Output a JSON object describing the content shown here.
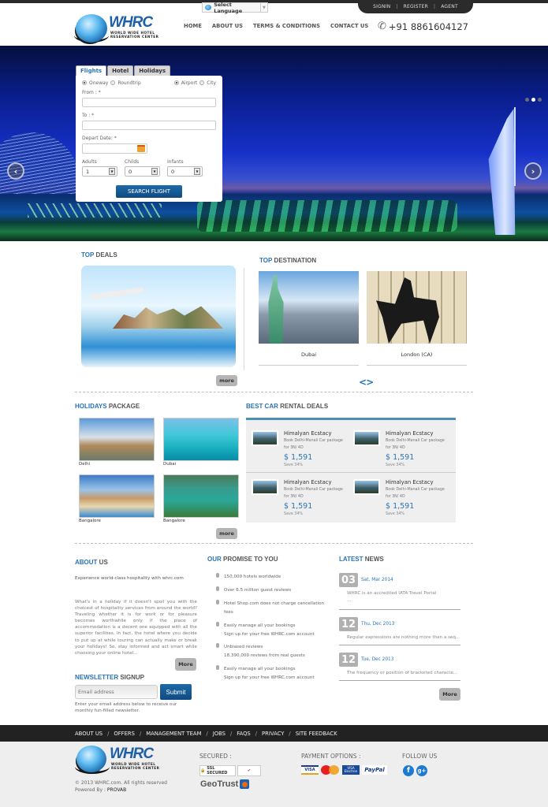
{
  "header": {
    "language_selector": "Select Language",
    "account_links": [
      "SIGNIN",
      "REGISTER",
      "AGENT"
    ],
    "logo": {
      "title": "WHRC",
      "subtitle_line1": "WORLD WIDE HOTEL",
      "subtitle_line2": "RESERVATION CENTER"
    },
    "nav": [
      "HOME",
      "ABOUT US",
      "TERMS & CONDITIONS",
      "CONTACT US"
    ],
    "phone": "+91 8861604127"
  },
  "hero": {
    "slides_total": 3,
    "active_slide": 2,
    "prev_icon": "chevron-left-icon",
    "next_icon": "chevron-right-icon"
  },
  "search": {
    "tabs": [
      "Flights",
      "Hotel",
      "Holidays"
    ],
    "active_tab": "Flights",
    "trip_type": {
      "options": [
        "Oneway",
        "Roundtrip"
      ],
      "selected": "Oneway"
    },
    "location_type": {
      "options": [
        "Airport",
        "City"
      ],
      "selected": "Airport"
    },
    "from_label": "From : *",
    "from_value": "",
    "to_label": "To : *",
    "to_value": "",
    "depart_label": "Depart Date: *",
    "depart_value": "",
    "adults_label": "Adults",
    "adults_value": "1",
    "childs_label": "Childs",
    "childs_value": "0",
    "infants_label": "Infants",
    "infants_value": "0",
    "submit_label": "SEARCH FLIGHT"
  },
  "top_deals": {
    "title_accent": "TOP",
    "title_rest": " DEALS",
    "more_label": "more"
  },
  "top_destination": {
    "title_accent": "TOP",
    "title_rest": " DESTINATION",
    "items": [
      {
        "name": "Dubai"
      },
      {
        "name": "London (CA)"
      }
    ],
    "prev_label": "<",
    "next_label": ">"
  },
  "holidays": {
    "title_accent": "HOLIDAYS",
    "title_rest": " PACKAGE",
    "items": [
      {
        "name": "Delhi"
      },
      {
        "name": "Dubai"
      },
      {
        "name": "Bangalore"
      },
      {
        "name": "Bangalore"
      }
    ],
    "more_label": "more"
  },
  "car_rentals": {
    "title_accent": "BEST CAR",
    "title_rest": " RENTAL DEALS",
    "items": [
      {
        "title": "Himalyan Ecstacy",
        "desc1": "Book Delhi-Manali Car package",
        "desc2": "for 3N/ 4D",
        "price": "$ 1,591",
        "save": "Save 34%"
      },
      {
        "title": "Himalyan Ecstacy",
        "desc1": "Book Delhi-Manali Car package",
        "desc2": "for 3N/ 4D",
        "price": "$ 1,591",
        "save": "Save 34%"
      },
      {
        "title": "Himalyan Ecstacy",
        "desc1": "Book Delhi-Manali Car package",
        "desc2": "for 3N/ 4D",
        "price": "$ 1,591",
        "save": "Save 34%"
      },
      {
        "title": "Himalyan Ecstacy",
        "desc1": "Book Delhi-Manali Car package",
        "desc2": "for 3N/ 4D",
        "price": "$ 1,591",
        "save": "Save 34%"
      }
    ]
  },
  "about": {
    "title_accent": "ABOUT",
    "title_rest": " US",
    "lead": "Experience world-class hospitality with whrc.com",
    "body": "What's in a holiday if it doesn't spoil you with the choicest of hospitality services from around the world? Traveling whether it is for work or for pleasure becomes worthwhile only if the place of accommodation is a decent one equipped with all the superior facilities. In fact, the hotel where you decide to put up at while touring can actually make or break your holidays! So, stay informed and act smart while choosing your online hotel...",
    "more_label": "More"
  },
  "newsletter": {
    "title_accent": "NEWSLETTER",
    "title_rest": " SIGNUP",
    "placeholder": "Email address",
    "submit_label": "Submit",
    "note": "Enter your email address below to receive our monthly fun-filled newsletter."
  },
  "promise": {
    "title_accent": "OUR",
    "title_rest": " PROMISE TO YOU",
    "items": [
      {
        "line1": "150,000 hotels worldwide",
        "line2": ""
      },
      {
        "line1": "Over 6.5 million guest reviews",
        "line2": ""
      },
      {
        "line1": "Hotel Shop.com does not charge cancellation fees",
        "line2": ""
      },
      {
        "line1": "Easily manage all your bookings",
        "line2": "Sign up for your free WHRC.com account"
      },
      {
        "line1": "Unbiased reviews",
        "line2": "18,390,000 reviews from real guests"
      },
      {
        "line1": "Easily manage all your bookings",
        "line2": "Sign up for your free WHRC.com account"
      }
    ]
  },
  "news": {
    "title_accent": "LATEST",
    "title_rest": " NEWS",
    "items": [
      {
        "day": "03",
        "date": "Sat, Mar 2014",
        "text": "WHRC is an accredited IATA Travel Portal",
        "extra": "..."
      },
      {
        "day": "12",
        "date": "Thu, Dec 2013",
        "text": "Regular expressions are nothing more than a seq...",
        "extra": ""
      },
      {
        "day": "12",
        "date": "Tue, Dec 2013",
        "text": "The frequency or position of bracketed characte...",
        "extra": ""
      }
    ],
    "more_label": "More"
  },
  "footer": {
    "links": [
      "ABOUT US",
      "OFFERS",
      "MANAGEMENT TEAM",
      "JOBS",
      "FAQS",
      "PRIVACY",
      "SITE FEEDBACK"
    ],
    "copyright": "© 2013 WHRC.com. All rights reserved",
    "powered_by_label": "Powered By : ",
    "powered_by": "PROVAB",
    "secured_title": "SECURED :",
    "secured_badges": [
      "SSL SECURED",
      "Verified",
      "GeoTrust"
    ],
    "payment_title": "PAYMENT OPTIONS :",
    "payment_methods": [
      "VISA",
      "MasterCard",
      "VISA Electron",
      "PayPal"
    ],
    "follow_title": "FOLLOW US",
    "social": [
      "facebook-icon",
      "google-plus-icon"
    ]
  }
}
